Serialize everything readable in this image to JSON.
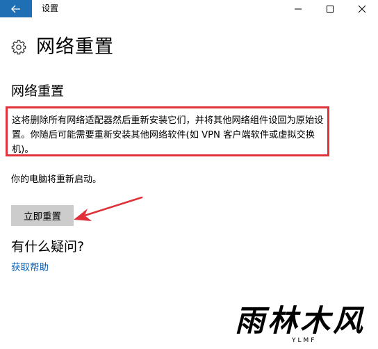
{
  "window": {
    "title": "设置",
    "accent": "#1f6fb5"
  },
  "page": {
    "title": "网络重置"
  },
  "section": {
    "title": "网络重置",
    "description": "这将删除所有网络适配器然后重新安装它们，并将其他网络组件设回为原始设置。你随后可能需要重新安装其他网络软件(如 VPN 客户端软件或虚拟交换机)。",
    "restart_note": "你的电脑将重新启动。",
    "reset_button": "立即重置",
    "highlight_color": "#e0323a"
  },
  "help": {
    "question": "有什么疑问?",
    "link": "获取帮助"
  },
  "watermark": {
    "logo": "雨林木风",
    "sub": "YLMF"
  },
  "icons": {
    "back": "back-arrow-icon",
    "gear": "gear-icon",
    "minimize": "minimize-icon",
    "maximize": "maximize-icon",
    "close": "close-icon"
  }
}
